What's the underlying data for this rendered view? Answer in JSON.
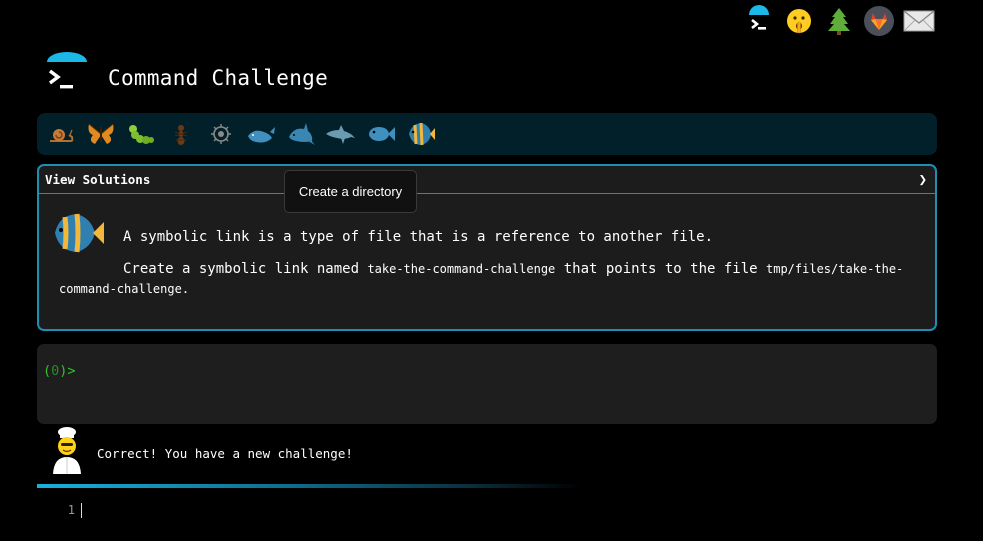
{
  "header": {
    "title": "Command Challenge",
    "top_icons": [
      "terminal-icon",
      "shushing-face-icon",
      "tree-icon",
      "gitlab-icon",
      "envelope-icon"
    ]
  },
  "levels": [
    "snail",
    "butterfly",
    "caterpillar",
    "ant",
    "microbe",
    "whale",
    "shark",
    "dolphin",
    "fish",
    "tropical-fish"
  ],
  "challenge": {
    "view_solutions": "View Solutions",
    "chevron": "❯",
    "intro": "A symbolic link is a type of file that is a reference to another file.",
    "desc_part1": "Create a symbolic link named ",
    "link_name": "take-the-command-challenge",
    "desc_part2": " that points to the file ",
    "target_path": "tmp/files/take-the-command-challenge",
    "desc_end": "."
  },
  "tooltip": "Create a directory",
  "terminal": {
    "prompt_open": "(",
    "prompt_count": "0",
    "prompt_close": ")>"
  },
  "feedback": {
    "message": "Correct! You have a new challenge!"
  },
  "editor": {
    "line_number": "1"
  },
  "colors": {
    "accent": "#1d8fb0",
    "prompt_green": "#2fc42f",
    "level_bar": "#022029"
  }
}
